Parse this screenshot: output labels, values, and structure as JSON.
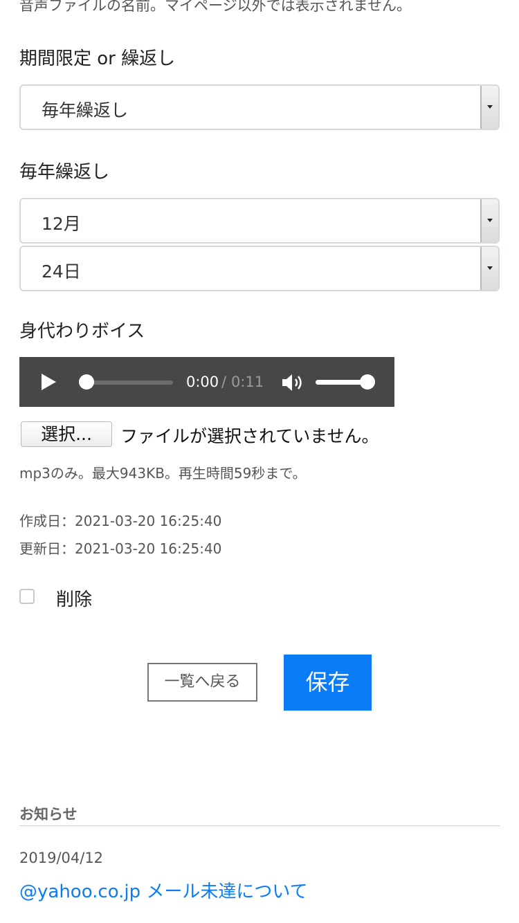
{
  "voice_name_hint": "音声ファイルの名前。マイページ以外では表示されません。",
  "period": {
    "label": "期間限定 or 繰返し",
    "selected": "毎年繰返し"
  },
  "repeat": {
    "label": "毎年繰返し",
    "month_selected": "12月",
    "day_selected": "24日"
  },
  "voice": {
    "label": "身代わりボイス",
    "player": {
      "current_time": "0:00",
      "separator": "/",
      "duration": "0:11",
      "play_progress": 0,
      "volume_level": 1.0,
      "play_icon": "play-icon",
      "volume_icon": "volume-icon"
    },
    "file_button_label": "選択...",
    "file_status": "ファイルが選択されていません。",
    "file_hint": "mp3のみ。最大943KB。再生時間59秒まで。"
  },
  "meta": {
    "created": "作成日：2021-03-20 16:25:40",
    "updated": "更新日：2021-03-20 16:25:40"
  },
  "delete": {
    "label": "削除",
    "checked": false
  },
  "actions": {
    "back_label": "一覧へ戻る",
    "save_label": "保存"
  },
  "news": {
    "heading": "お知らせ",
    "items": [
      {
        "date": "2019/04/12",
        "title": "@yahoo.co.jp メール未達について"
      }
    ]
  },
  "colors": {
    "accent": "#0a7cf5",
    "player_bg": "#474747"
  }
}
